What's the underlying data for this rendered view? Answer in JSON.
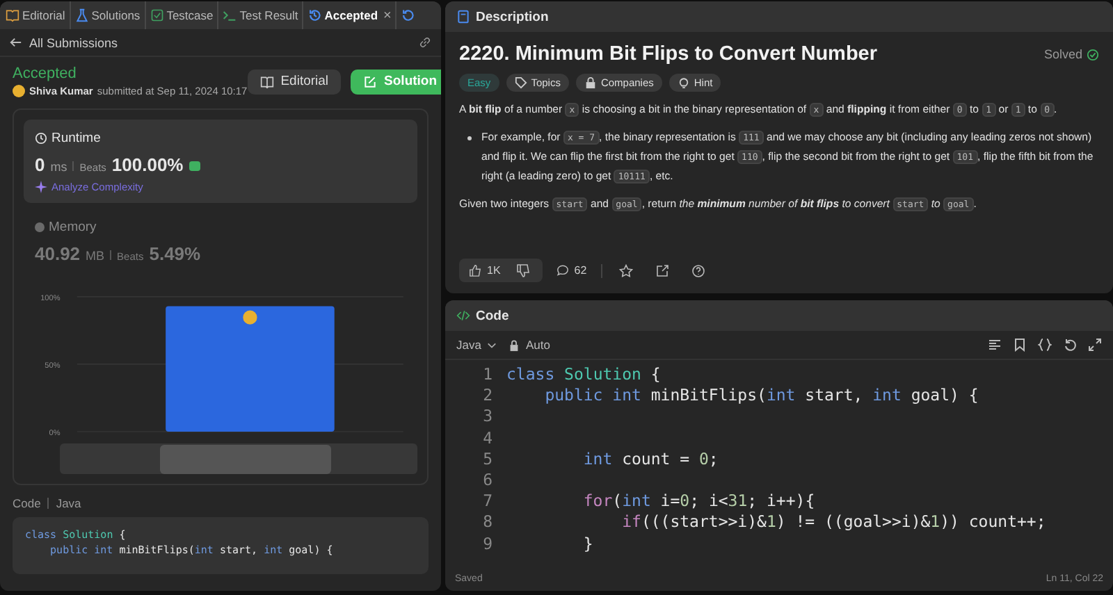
{
  "left_tabs": [
    {
      "label": "Editorial",
      "selected": false,
      "kind": "book"
    },
    {
      "label": "Solutions",
      "selected": false,
      "kind": "flask"
    },
    {
      "label": "Testcase",
      "selected": false,
      "kind": "check"
    },
    {
      "label": "Test Result",
      "selected": false,
      "kind": "terminal"
    },
    {
      "label": "Accepted",
      "selected": true,
      "kind": "history"
    }
  ],
  "close_glyph": "×",
  "back": {
    "label": "All Submissions"
  },
  "submission": {
    "status": "Accepted",
    "author": "Shiva Kumar",
    "submitted": "submitted at Sep 11, 2024 10:17",
    "buttons": [
      {
        "label": "Editorial",
        "kind": "secondary"
      },
      {
        "label": "Solution",
        "kind": "primary"
      }
    ]
  },
  "runtime": {
    "title": "Runtime",
    "value": "0",
    "unit": "ms",
    "beats_label": "Beats",
    "beats": "100.00%",
    "analyze": "Analyze Complexity"
  },
  "memory": {
    "title": "Memory",
    "value": "40.92",
    "unit": "MB",
    "beats_label": "Beats",
    "beats": "5.49%"
  },
  "chart_data": {
    "type": "bar",
    "values": [
      93
    ],
    "ylim": [
      0,
      100
    ],
    "yticks": [
      {
        "value": 0,
        "label": "0%"
      },
      {
        "value": 50,
        "label": "50%"
      },
      {
        "value": 100,
        "label": "100%"
      }
    ]
  },
  "code_label": "Code",
  "code_lang": "Java",
  "left_code": [
    {
      "tokens": [
        {
          "t": "class ",
          "kind": "kw"
        },
        {
          "t": "Solution",
          "kind": "type"
        },
        {
          "t": " {"
        }
      ],
      "children": [
        {
          "tokens": [
            {
              "t": "public ",
              "kind": "kw"
            },
            {
              "t": "int ",
              "kind": "kw"
            },
            {
              "t": "minBitFlips("
            },
            {
              "t": "int ",
              "kind": "kw"
            },
            {
              "t": "start, "
            },
            {
              "t": "int ",
              "kind": "kw"
            },
            {
              "t": "goal) {"
            }
          ]
        }
      ]
    }
  ],
  "description": {
    "tab": "Description",
    "title": "2220. Minimum Bit Flips to Convert Number",
    "solved": "Solved",
    "tags": [
      {
        "label": "Easy",
        "kind": "difficulty"
      },
      {
        "label": "Topics",
        "kind": "tag"
      },
      {
        "label": "Companies",
        "kind": "lock"
      },
      {
        "label": "Hint",
        "kind": "bulb"
      }
    ],
    "paragraphs": [
      {
        "kind": "p",
        "segments": [
          {
            "t": "A "
          },
          {
            "t": "bit flip",
            "kind": "b"
          },
          {
            "t": " of a number "
          },
          {
            "t": "x",
            "kind": "code"
          },
          {
            "t": " is choosing a bit in the binary representation of "
          },
          {
            "t": "x",
            "kind": "code"
          },
          {
            "t": " and "
          },
          {
            "t": "flipping",
            "kind": "b"
          },
          {
            "t": " it from either "
          },
          {
            "t": "0",
            "kind": "code"
          },
          {
            "t": " to "
          },
          {
            "t": "1",
            "kind": "code"
          },
          {
            "t": " or "
          },
          {
            "t": "1",
            "kind": "code"
          },
          {
            "t": " to "
          },
          {
            "t": "0",
            "kind": "code"
          },
          {
            "t": "."
          }
        ]
      },
      {
        "kind": "bullet",
        "segments": [
          {
            "t": "For example, for "
          },
          {
            "t": "x = 7",
            "kind": "code"
          },
          {
            "t": ", the binary representation is "
          },
          {
            "t": "111",
            "kind": "code"
          },
          {
            "t": " and we may choose any bit (including any leading zeros not shown) and flip it. We can flip the first bit from the right to get "
          },
          {
            "t": "110",
            "kind": "code"
          },
          {
            "t": ", flip the second bit from the right to get "
          },
          {
            "t": "101",
            "kind": "code"
          },
          {
            "t": ", flip the fifth bit from the right (a leading zero) to get "
          },
          {
            "t": "10111",
            "kind": "code"
          },
          {
            "t": ", etc."
          }
        ]
      },
      {
        "kind": "p",
        "segments": [
          {
            "t": "Given two integers "
          },
          {
            "t": "start",
            "kind": "code"
          },
          {
            "t": " and "
          },
          {
            "t": "goal",
            "kind": "code"
          },
          {
            "t": ", return "
          },
          {
            "t": "the ",
            "kind": "i"
          },
          {
            "t": "minimum",
            "kind": "bi"
          },
          {
            "t": " number of ",
            "kind": "i"
          },
          {
            "t": "bit flips",
            "kind": "bi"
          },
          {
            "t": " to convert ",
            "kind": "i"
          },
          {
            "t": "start",
            "kind": "code"
          },
          {
            "t": " to ",
            "kind": "i"
          },
          {
            "t": "goal",
            "kind": "code"
          },
          {
            "t": "."
          }
        ]
      }
    ],
    "likes": "1K",
    "comments": "62"
  },
  "editor": {
    "tab": "Code",
    "language": "Java",
    "mode": "Auto",
    "status": "Saved",
    "cursor": "Ln 11, Col 22",
    "lines": [
      {
        "n": "1",
        "tokens": [
          {
            "t": "class ",
            "kind": "kw"
          },
          {
            "t": "Solution",
            "kind": "type"
          },
          {
            "t": " {"
          }
        ],
        "children": [
          {
            "n": "2",
            "tokens": [
              {
                "t": "public ",
                "kind": "kw"
              },
              {
                "t": "int ",
                "kind": "kw"
              },
              {
                "t": "minBitFlips("
              },
              {
                "t": "int ",
                "kind": "kw"
              },
              {
                "t": "start, "
              },
              {
                "t": "int ",
                "kind": "kw"
              },
              {
                "t": "goal) {"
              }
            ],
            "children": [
              {
                "n": "3"
              },
              {
                "n": "4"
              },
              {
                "n": "5",
                "tokens": [
                  {
                    "t": "int ",
                    "kind": "kw"
                  },
                  {
                    "t": "count = "
                  },
                  {
                    "t": "0",
                    "kind": "num"
                  },
                  {
                    "t": ";"
                  }
                ]
              },
              {
                "n": "6"
              },
              {
                "n": "7",
                "tokens": [
                  {
                    "t": "for",
                    "kind": "ctl"
                  },
                  {
                    "t": "("
                  },
                  {
                    "t": "int ",
                    "kind": "kw"
                  },
                  {
                    "t": "i="
                  },
                  {
                    "t": "0",
                    "kind": "num"
                  },
                  {
                    "t": "; i<"
                  },
                  {
                    "t": "31",
                    "kind": "num"
                  },
                  {
                    "t": "; i++){"
                  }
                ],
                "children": [
                  {
                    "n": "8",
                    "tokens": [
                      {
                        "t": "if",
                        "kind": "ctl"
                      },
                      {
                        "t": "(((start>>i)&"
                      },
                      {
                        "t": "1",
                        "kind": "num"
                      },
                      {
                        "t": ") != ((goal>>i)&"
                      },
                      {
                        "t": "1",
                        "kind": "num"
                      },
                      {
                        "t": ")) count++;"
                      }
                    ]
                  }
                ]
              },
              {
                "n": "9",
                "tokens": [
                  {
                    "t": "}"
                  }
                ]
              }
            ]
          }
        ]
      }
    ]
  }
}
